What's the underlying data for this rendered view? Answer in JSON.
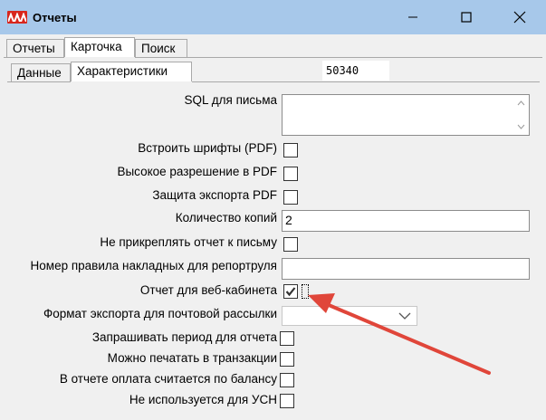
{
  "window": {
    "title": "Отчеты",
    "icon": "app-logo-icon",
    "controls": [
      "minimize-icon",
      "maximize-icon",
      "close-icon"
    ]
  },
  "tabs_top": [
    {
      "label": "Отчеты",
      "active": false
    },
    {
      "label": "Карточка",
      "active": true
    },
    {
      "label": "Поиск",
      "active": false
    }
  ],
  "tabs_sub": [
    {
      "label": "Данные",
      "active": false
    },
    {
      "label": "Характеристики",
      "active": true
    }
  ],
  "record_id": "50340",
  "fields": {
    "sql_letter": {
      "label": "SQL для письма",
      "value": ""
    },
    "embed_fonts": {
      "label": "Встроить шрифты (PDF)",
      "checked": false
    },
    "high_res_pdf": {
      "label": "Высокое разрешение в PDF",
      "checked": false
    },
    "export_protect_pdf": {
      "label": "Защита экспорта PDF",
      "checked": false
    },
    "copies": {
      "label": "Количество копий",
      "value": "2"
    },
    "no_attach": {
      "label": "Не прикреплять отчет к письму",
      "checked": false
    },
    "rule_number": {
      "label": "Номер правила накладных для репортруля",
      "value": ""
    },
    "web_cabinet": {
      "label": "Отчет для веб-кабинета",
      "checked": true
    },
    "mail_export_format": {
      "label": "Формат экспорта для почтовой рассылки",
      "value": ""
    },
    "ask_period": {
      "label": "Запрашивать период для отчета",
      "checked": false
    },
    "print_in_transaction": {
      "label": "Можно печатать в транзакции",
      "checked": false
    },
    "balance_payment": {
      "label": "В отчете оплата считается по балансу",
      "checked": false
    },
    "not_for_usn": {
      "label": "Не используется для УСН",
      "checked": false
    }
  },
  "colors": {
    "titlebar": "#a7c8ea",
    "annotation_arrow": "#e0463a",
    "logo": "#d8261c"
  }
}
